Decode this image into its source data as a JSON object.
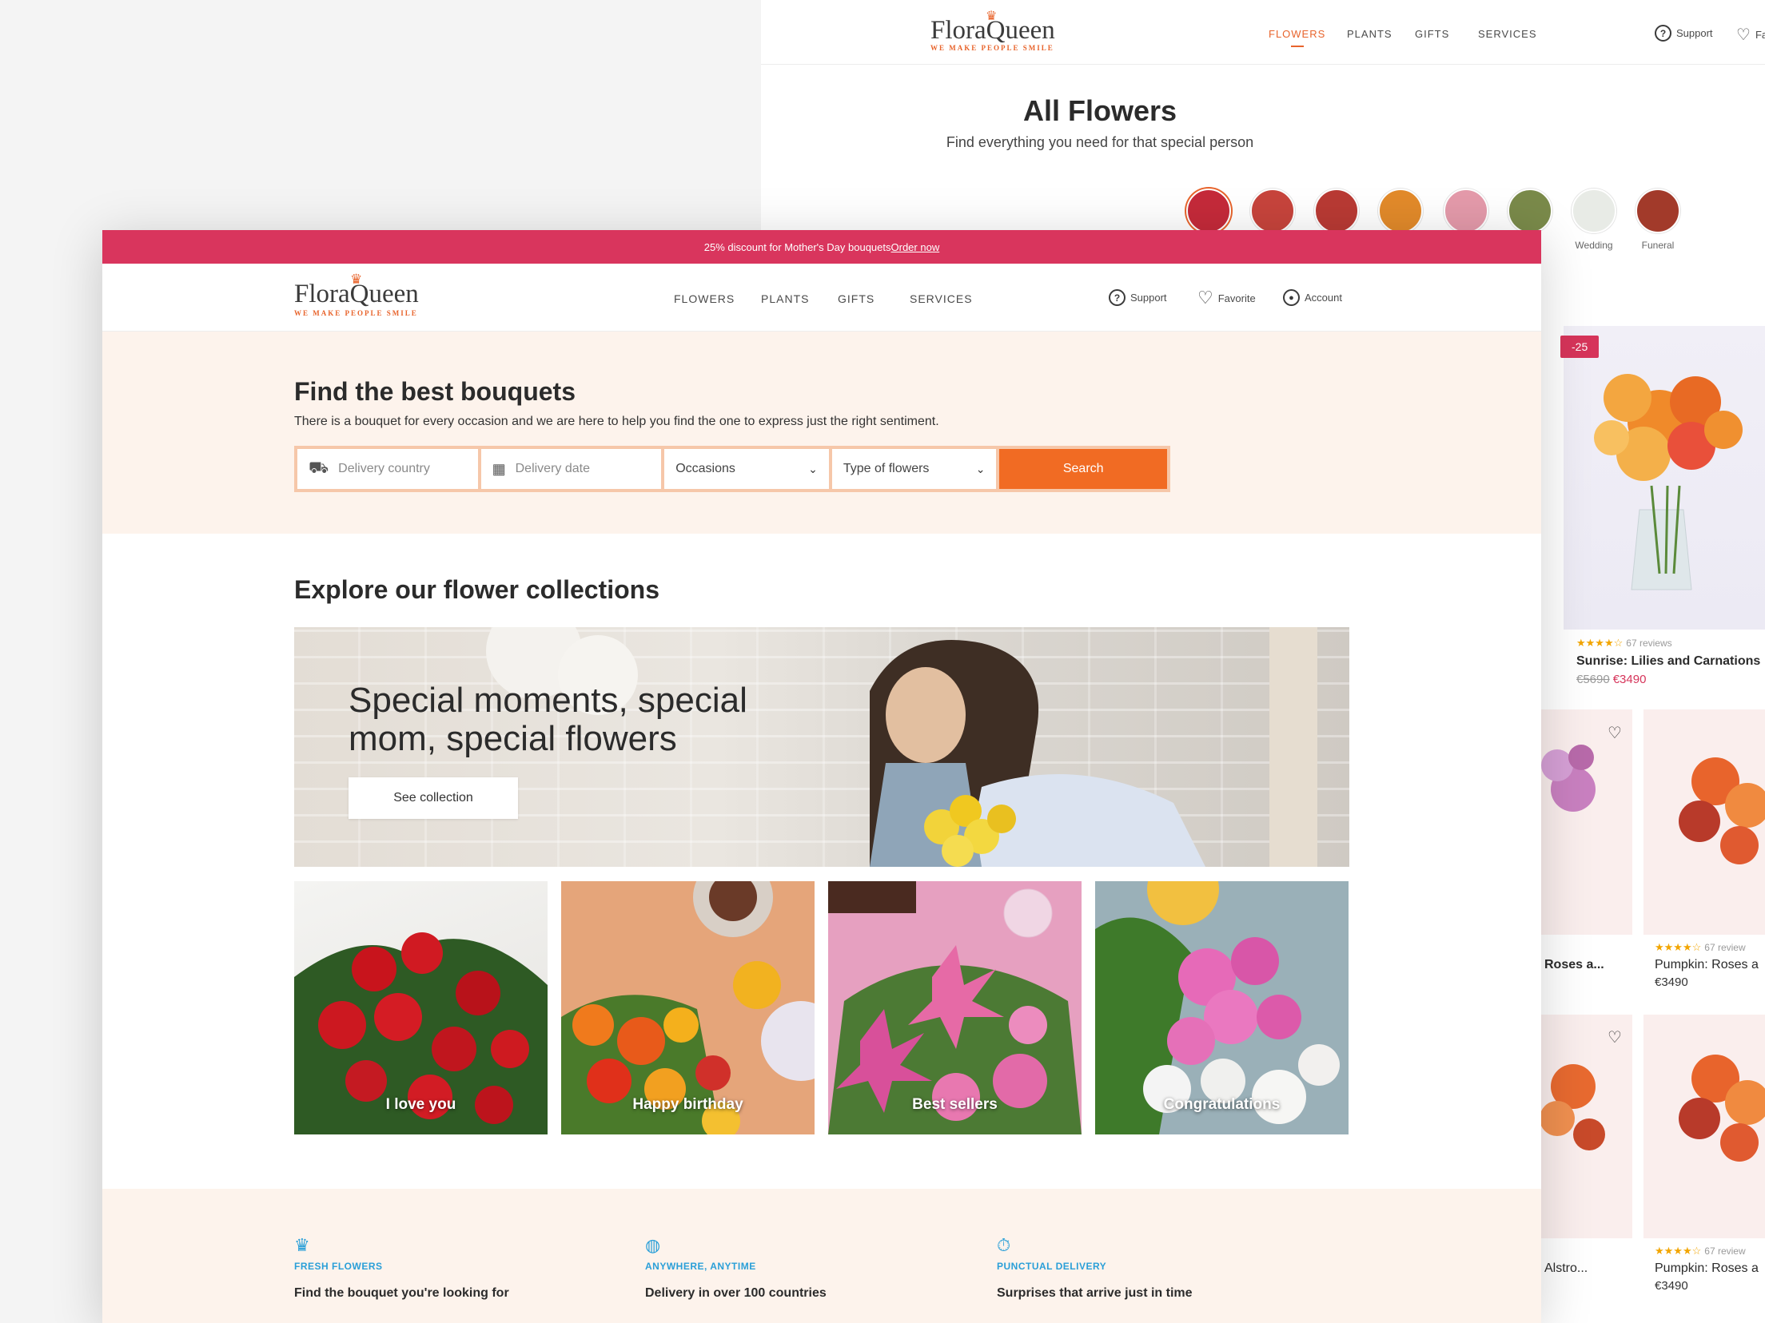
{
  "background_page": {
    "logo": {
      "name_a": "Flora",
      "name_b": "Queen",
      "tagline": "WE MAKE PEOPLE SMILE"
    },
    "nav": [
      "FLOWERS",
      "PLANTS",
      "GIFTS",
      "SERVICES"
    ],
    "support": "Support",
    "favorite_truncated": "Fa",
    "title": "All Flowers",
    "subtitle": "Find everything you need for that special person",
    "categories": [
      {
        "label": "",
        "color": "#c52a3a"
      },
      {
        "label": "",
        "color": "#c7443c"
      },
      {
        "label": "",
        "color": "#b93a34"
      },
      {
        "label": "",
        "color": "#e28a2a"
      },
      {
        "label": "",
        "color": "#e49aaa"
      },
      {
        "label": "",
        "color": "#7a8a4a"
      },
      {
        "label": "Wedding",
        "color": "#e8ebe6"
      },
      {
        "label": "Funeral",
        "color": "#a23a2a"
      }
    ],
    "products": [
      {
        "badge": "-25",
        "stars": "★★★★☆",
        "reviews": "67 reviews",
        "name": "Sunrise: Lilies and Carnations",
        "old_price": "€5690",
        "price": "€3490"
      },
      {
        "name": "Roses a...",
        "stars": "",
        "reviews": "",
        "price": ""
      },
      {
        "name": "Pumpkin: Roses a",
        "stars": "★★★★☆",
        "reviews": "67 review",
        "price": "€3490"
      },
      {
        "name": "Alstro...",
        "stars": "",
        "reviews": "",
        "price": ""
      },
      {
        "name": "Pumpkin: Roses a",
        "stars": "★★★★☆",
        "reviews": "67 review",
        "price": "€3490"
      }
    ]
  },
  "promo": {
    "text": "25% discount for Mother's Day bouquets",
    "link": "Order now"
  },
  "header": {
    "logo": {
      "name_a": "Flora",
      "name_b": "Queen",
      "tagline": "WE MAKE PEOPLE SMILE"
    },
    "nav": [
      "FLOWERS",
      "PLANTS",
      "GIFTS",
      "SERVICES"
    ],
    "support": "Support",
    "favorite": "Favorite",
    "account": "Account"
  },
  "hero": {
    "title": "Find the best bouquets",
    "subtitle": "There is a bouquet for every occasion and we are here to help you find the one to express just the right sentiment.",
    "search": {
      "country_placeholder": "Delivery country",
      "date_placeholder": "Delivery date",
      "occasions": "Occasions",
      "type": "Type of flowers",
      "button": "Search"
    }
  },
  "collections": {
    "title": "Explore our flower collections",
    "banner": {
      "text": "Special moments, special mom, special flowers",
      "button": "See collection"
    },
    "tiles": [
      {
        "label": "I love you",
        "color": "#c8262e"
      },
      {
        "label": "Happy birthday",
        "color": "#e39a48"
      },
      {
        "label": "Best sellers",
        "color": "#d86ea6"
      },
      {
        "label": "Congratulations",
        "color": "#d96aa8"
      }
    ]
  },
  "features": [
    {
      "icon": "crown-icon",
      "title": "FRESH FLOWERS",
      "desc": "Find the bouquet you're looking for"
    },
    {
      "icon": "globe-icon",
      "title": "ANYWHERE, ANYTIME",
      "desc": "Delivery in over 100 countries"
    },
    {
      "icon": "fast-delivery-icon",
      "title": "PUNCTUAL DELIVERY",
      "desc": "Surprises that arrive just in time"
    }
  ],
  "colors": {
    "accent": "#f16b23",
    "promo": "#d9355d",
    "feature_blue": "#2a9fd8"
  }
}
